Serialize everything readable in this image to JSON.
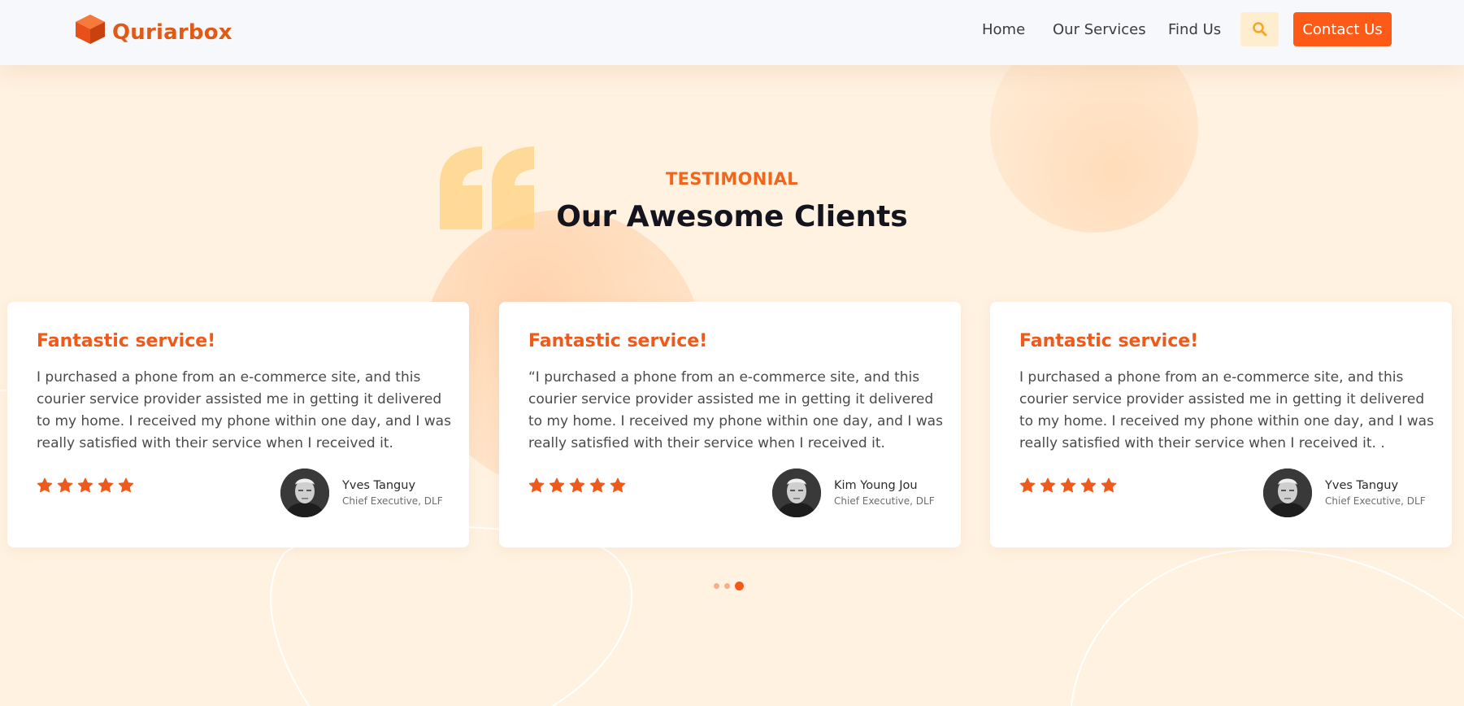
{
  "header": {
    "logo_text": "Quriarbox",
    "nav": [
      {
        "label": "Home"
      },
      {
        "label": "Our Services"
      },
      {
        "label": "Find Us"
      }
    ],
    "search_icon": "search-icon",
    "contact_label": "Contact Us"
  },
  "section": {
    "label": "TESTIMONIAL",
    "title": "Our Awesome Clients"
  },
  "testimonials": [
    {
      "heading": "Fantastic service!",
      "text": "I purchased a phone from an e-commerce site, and this courier service provider assisted me in getting it delivered to my home. I received my phone within one day, and I was really satisfied with their service when I received it.",
      "rating": 5,
      "name": "Yves Tanguy",
      "role": "Chief Executive, DLF"
    },
    {
      "heading": "Fantastic service!",
      "text": "“I purchased a phone from an e-commerce site, and this courier service provider assisted me in getting it delivered to my home. I received my phone within one day, and I was really satisfied with their service when I received it.",
      "rating": 5,
      "name": "Kim Young Jou",
      "role": "Chief Executive, DLF"
    },
    {
      "heading": "Fantastic service!",
      "text": "I purchased a phone from an e-commerce site, and this courier service provider assisted me in getting it delivered to my home. I received my phone within one day, and I was really satisfied with their service when I received it. .",
      "rating": 5,
      "name": "Yves Tanguy",
      "role": "Chief Executive, DLF"
    }
  ],
  "carousel": {
    "pages": 3,
    "active_page": 3
  },
  "colors": {
    "accent": "#fd5a17",
    "heading_orange": "#ee5a1c",
    "background": "#fff2e1",
    "header_bg": "#f7f8fc",
    "search_bg": "#ffedcf",
    "search_icon": "#f5a623"
  }
}
